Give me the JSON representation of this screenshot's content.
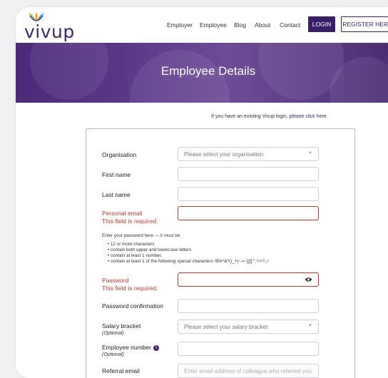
{
  "header": {
    "logo_text": "vivup",
    "nav": [
      "Employer",
      "Employee",
      "Blog",
      "About",
      "Contact"
    ],
    "login_label": "LOGIN",
    "register_label": "REGISTER HERE"
  },
  "banner": {
    "title": "Employee Details"
  },
  "existing": {
    "text": "If you have an existing Vivup login,",
    "link": "please click here"
  },
  "form": {
    "organisation": {
      "label": "Organisation",
      "placeholder": "Please select your organisation"
    },
    "first_name": {
      "label": "First name"
    },
    "last_name": {
      "label": "Last name"
    },
    "personal_email": {
      "label": "Personal email",
      "error": "This field is required."
    },
    "password_hint": "Enter your password here — it must be",
    "password_rules": [
      "12 or more characters",
      "contain both upper and lowercase letters",
      "contain at least 1 number.",
      "contain at least 1 of the following special characters !$%^&*()_+|~-=`{}[]:\";'<>?,./"
    ],
    "password": {
      "label": "Password",
      "error": "This field is required."
    },
    "password_confirmation": {
      "label": "Password confirmation"
    },
    "salary_bracket": {
      "label": "Salary bracket",
      "optional": "(Optional)",
      "placeholder": "Please select your salary bracket"
    },
    "employee_number": {
      "label": "Employee number",
      "optional": "(Optional)"
    },
    "referral_email": {
      "label": "Referral email",
      "placeholder": "Enter email address of colleague who referred you"
    }
  },
  "colors": {
    "brand": "#3b1f66",
    "error": "#c0392b"
  }
}
